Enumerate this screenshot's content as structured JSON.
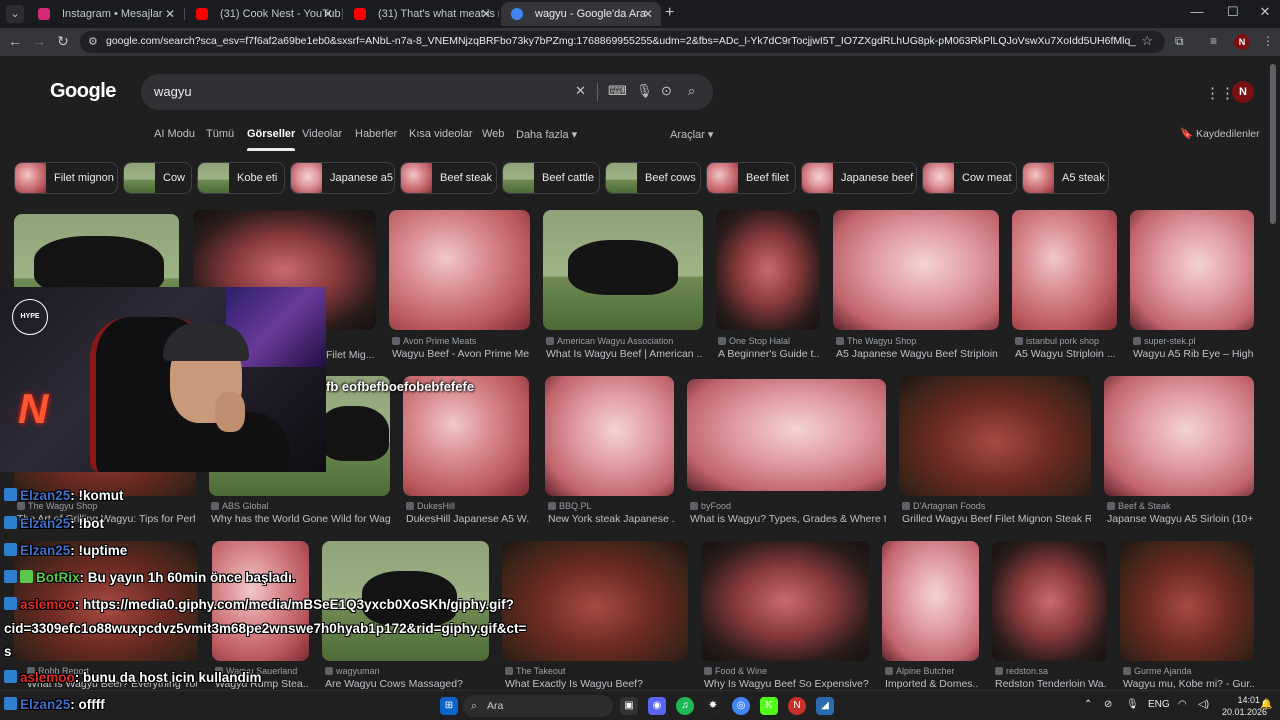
{
  "browser": {
    "tabs": [
      {
        "title": "Instagram • Mesajlar",
        "color": "#d62976"
      },
      {
        "title": "(31) Cook Nest - YouTube",
        "color": "#ff0000"
      },
      {
        "title": "(31) That's what meat is made",
        "color": "#ff0000"
      },
      {
        "title": "wagyu - Google'da Ara",
        "color": "#4285f4"
      }
    ],
    "url": "google.com/search?sca_esv=f7f6af2a69be1eb0&sxsrf=ANbL-n7a-8_VNEMNjzqBRFbo73ky7bPZmg:1768869955255&udm=2&fbs=ADc_l-Yk7dC9rTocjjwI5T_IO7ZXgdRLhUG8pk-pM063RkPlLQJoVswXu7XoIdd5UH6fMlq_s9nb4YoXhm4SVUwlynGO-Epl..."
  },
  "google": {
    "logo": "Google",
    "query": "wagyu",
    "nav_tabs": [
      "AI Modu",
      "Tümü",
      "Görseller",
      "Videolar",
      "Haberler",
      "Kısa videolar",
      "Web",
      "Daha fazla ▾",
      "Araçlar ▾"
    ],
    "saved": "Kaydedilenler",
    "chips": [
      "Filet mignon",
      "Cow",
      "Kobe eti",
      "Japanese a5",
      "Beef steak",
      "Beef cattle",
      "Beef cows",
      "Beef filet",
      "Japanese beef",
      "Cow meat",
      "A5 steak"
    ],
    "results": [
      {
        "source": "",
        "caption": ""
      },
      {
        "source": "",
        "caption": "Filet Mig..."
      },
      {
        "source": "Avon Prime Meats",
        "caption": "Wagyu Beef - Avon Prime Me..."
      },
      {
        "source": "American Wagyu Association",
        "caption": "What Is Wagyu Beef | American ..."
      },
      {
        "source": "One Stop Halal",
        "caption": "A Beginner's Guide t..."
      },
      {
        "source": "The Wagyu Shop",
        "caption": "A5 Japanese Wagyu Beef Striploin ..."
      },
      {
        "source": "istanbul pork shop",
        "caption": "A5 Wagyu Striploin ..."
      },
      {
        "source": "super-stek.pl",
        "caption": "Wagyu A5 Rib Eye – High..."
      },
      {
        "source": "The Wagyu Shop",
        "caption": "The Art of Grilling Wagyu: Tips for Perf..."
      },
      {
        "source": "ABS Global",
        "caption": "Why has the World Gone Wild for Wag..."
      },
      {
        "source": "DukesHill",
        "caption": "DukesHill Japanese A5 W..."
      },
      {
        "source": "BBQ.PL",
        "caption": "New York steak Japanese ..."
      },
      {
        "source": "byFood",
        "caption": "What is Wagyu? Types, Grades & Where t..."
      },
      {
        "source": "D'Artagnan Foods",
        "caption": "Grilled Wagyu Beef Filet Mignon Steak R..."
      },
      {
        "source": "Beef & Steak",
        "caption": "Japanse Wagyu A5 Sirloin (10+..."
      },
      {
        "source": "Robb Report",
        "caption": "What Is Wagyu Beef? Everything You..."
      },
      {
        "source": "Wagyu Sauerland",
        "caption": "Wagyu Rump Stea..."
      },
      {
        "source": "wagyuman",
        "caption": "Are Wagyu Cows Massaged?"
      },
      {
        "source": "The Takeout",
        "caption": "What Exactly Is Wagyu Beef?"
      },
      {
        "source": "Food & Wine",
        "caption": "Why Is Wagyu Beef So Expensive?"
      },
      {
        "source": "Alpine Butcher",
        "caption": "Imported & Domes..."
      },
      {
        "source": "redston.sa",
        "caption": "Redston Tenderloin Wa..."
      },
      {
        "source": "Gurme Ajanda",
        "caption": "Wagyu mu, Kobe mi? - Gur..."
      }
    ]
  },
  "stream": {
    "hype_badge": "HYPE",
    "overlay_text": "fb eofbefboefobebfefefe",
    "chat": [
      {
        "user": "Elzan25",
        "msg": ": !komut"
      },
      {
        "user": "Elzan25",
        "msg": ": !bot"
      },
      {
        "user": "Elzan25",
        "msg": ": !uptime"
      },
      {
        "user": "BotRix",
        "msg": ": Bu yayın 1h 60min önce başladı."
      },
      {
        "user": "aslemoo",
        "msg": ": https://media0.giphy.com/media/mBSeE1Q3yxcb0XoSKh/giphy.gif?"
      },
      {
        "user": "",
        "msg": "cid=3309efc1o88wuxpcdvz5vmit3m68pe2wnswe7h0hyab1p172&rid=giphy.gif&ct="
      },
      {
        "user": "",
        "msg": "s"
      },
      {
        "user": "aslemoo",
        "msg": ": bunu da host icin kullandim"
      },
      {
        "user": "Elzan25",
        "msg": ": offff"
      }
    ]
  },
  "taskbar": {
    "search_placeholder": "Ara",
    "lang": "ENG",
    "time": "14:01",
    "date": "20.01.2026"
  }
}
